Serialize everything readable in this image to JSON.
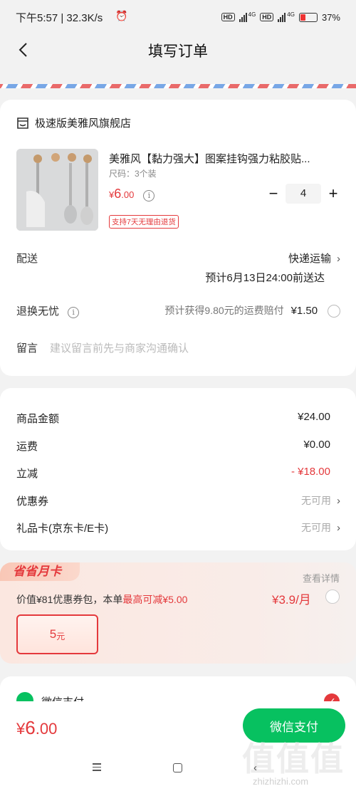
{
  "status_bar": {
    "time_speed": "下午5:57 | 32.3K/s",
    "hd1": "HD",
    "net1": "4G",
    "hd2": "HD",
    "net2": "4G",
    "battery": "37%"
  },
  "nav": {
    "title": "填写订单"
  },
  "shop": {
    "name": "极速版美雅风旗舰店"
  },
  "product": {
    "name": "美雅风【黏力强大】图案挂钩强力粘胶贴...",
    "spec": "尺码：3个装",
    "price_symbol": "¥",
    "price_int": "6",
    "price_dec": ".00",
    "tag": "支持7天无理由退货",
    "qty": "4",
    "minus": "−",
    "plus": "+"
  },
  "delivery": {
    "label": "配送",
    "method": "快递运输",
    "eta": "预计6月13日24:00前送达"
  },
  "return_worry": {
    "label": "退换无忧",
    "desc": "预计获得9.80元的运费赔付",
    "price": "¥1.50"
  },
  "message": {
    "label": "留言",
    "placeholder": "建议留言前先与商家沟通确认"
  },
  "summary": {
    "goods_label": "商品金额",
    "goods_value": "¥24.00",
    "shipping_label": "运费",
    "shipping_value": "¥0.00",
    "discount_label": "立减",
    "discount_value": "- ¥18.00",
    "coupon_label": "优惠券",
    "coupon_value": "无可用",
    "giftcard_label": "礼品卡(京东卡/E卡)",
    "giftcard_value": "无可用"
  },
  "monthly_card": {
    "title": "省省月卡",
    "detail": "查看详情",
    "desc_prefix": "价值¥81优惠券包，本单",
    "desc_highlight": "最高可减¥5.00",
    "price": "¥3.9/月",
    "coupon_amount": "5",
    "coupon_unit": "元"
  },
  "payment": {
    "label": "微信支付"
  },
  "bottom": {
    "total_symbol": "¥",
    "total_int": "6",
    "total_dec": ".00",
    "pay_button": "微信支付"
  },
  "watermark": {
    "text": "值值值",
    "sub": "zhizhizhi.com"
  },
  "colors": {
    "accent_red": "#e4393c",
    "wechat_green": "#07c160"
  }
}
